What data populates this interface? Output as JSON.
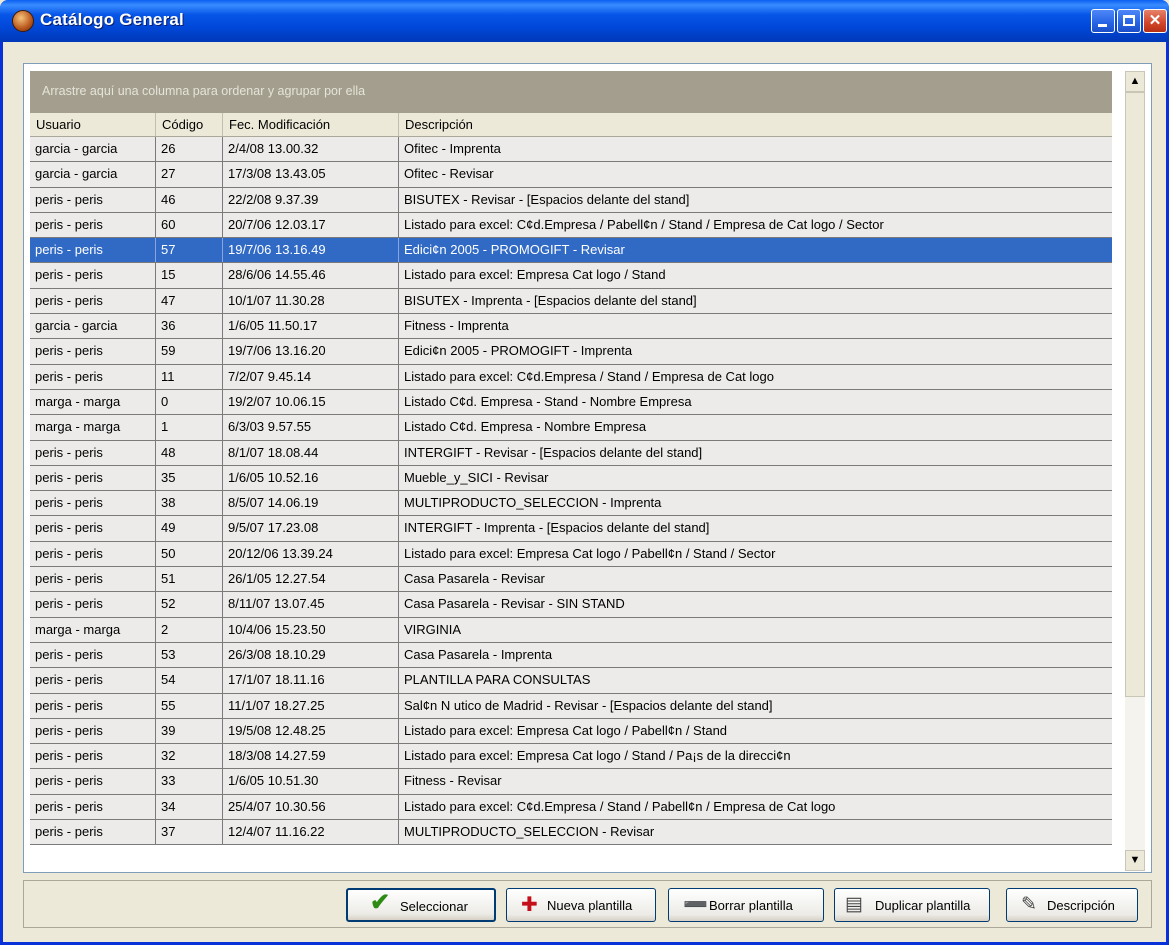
{
  "window": {
    "title": "Catálogo General"
  },
  "grid": {
    "group_hint": "Arrastre aquí una columna para ordenar y agrupar por ella",
    "columns": [
      "Usuario",
      "Código",
      "Fec. Modificación",
      "Descripción"
    ],
    "selected_index": 4,
    "rows": [
      [
        "garcia - garcia",
        "26",
        "2/4/08 13.00.32",
        "Ofitec - Imprenta"
      ],
      [
        "garcia - garcia",
        "27",
        "17/3/08 13.43.05",
        "Ofitec - Revisar"
      ],
      [
        "peris - peris",
        "46",
        "22/2/08 9.37.39",
        "BISUTEX - Revisar - [Espacios delante del stand]"
      ],
      [
        "peris - peris",
        "60",
        "20/7/06 12.03.17",
        "Listado para excel: C¢d.Empresa / Pabell¢n / Stand / Empresa de Cat logo / Sector"
      ],
      [
        "peris - peris",
        "57",
        "19/7/06 13.16.49",
        "Edici¢n 2005 - PROMOGIFT - Revisar"
      ],
      [
        "peris - peris",
        "15",
        "28/6/06 14.55.46",
        "Listado para excel: Empresa Cat logo / Stand"
      ],
      [
        "peris - peris",
        "47",
        "10/1/07 11.30.28",
        "BISUTEX - Imprenta - [Espacios delante del stand]"
      ],
      [
        "garcia - garcia",
        "36",
        "1/6/05 11.50.17",
        "Fitness - Imprenta"
      ],
      [
        "peris - peris",
        "59",
        "19/7/06 13.16.20",
        "Edici¢n 2005 - PROMOGIFT - Imprenta"
      ],
      [
        "peris - peris",
        "11",
        "7/2/07 9.45.14",
        "Listado para excel: C¢d.Empresa / Stand / Empresa de Cat logo"
      ],
      [
        "marga - marga",
        "0",
        "19/2/07 10.06.15",
        "Listado C¢d. Empresa - Stand - Nombre Empresa"
      ],
      [
        "marga - marga",
        "1",
        "6/3/03 9.57.55",
        "Listado C¢d. Empresa - Nombre Empresa"
      ],
      [
        "peris - peris",
        "48",
        "8/1/07 18.08.44",
        "INTERGIFT - Revisar - [Espacios delante del stand]"
      ],
      [
        "peris - peris",
        "35",
        "1/6/05 10.52.16",
        "Mueble_y_SICI - Revisar"
      ],
      [
        "peris - peris",
        "38",
        "8/5/07 14.06.19",
        "MULTIPRODUCTO_SELECCION - Imprenta"
      ],
      [
        "peris - peris",
        "49",
        "9/5/07 17.23.08",
        "INTERGIFT - Imprenta - [Espacios delante del stand]"
      ],
      [
        "peris - peris",
        "50",
        "20/12/06 13.39.24",
        "Listado para excel: Empresa Cat logo / Pabell¢n / Stand / Sector"
      ],
      [
        "peris - peris",
        "51",
        "26/1/05 12.27.54",
        "Casa Pasarela - Revisar"
      ],
      [
        "peris - peris",
        "52",
        "8/11/07 13.07.45",
        "Casa Pasarela - Revisar - SIN STAND"
      ],
      [
        "marga - marga",
        "2",
        "10/4/06 15.23.50",
        "VIRGINIA"
      ],
      [
        "peris - peris",
        "53",
        "26/3/08 18.10.29",
        "Casa Pasarela - Imprenta"
      ],
      [
        "peris - peris",
        "54",
        "17/1/07 18.11.16",
        "PLANTILLA PARA CONSULTAS"
      ],
      [
        "peris - peris",
        "55",
        "11/1/07 18.27.25",
        "Sal¢n N utico de Madrid - Revisar - [Espacios delante del stand]"
      ],
      [
        "peris - peris",
        "39",
        "19/5/08 12.48.25",
        "Listado para excel: Empresa Cat logo / Pabell¢n / Stand"
      ],
      [
        "peris - peris",
        "32",
        "18/3/08 14.27.59",
        "Listado para excel: Empresa Cat logo / Stand / Pa¡s de la direcci¢n"
      ],
      [
        "peris - peris",
        "33",
        "1/6/05 10.51.30",
        "Fitness - Revisar"
      ],
      [
        "peris - peris",
        "34",
        "25/4/07 10.30.56",
        "Listado para excel: C¢d.Empresa / Stand / Pabell¢n / Empresa de Cat logo"
      ],
      [
        "peris - peris",
        "37",
        "12/4/07 11.16.22",
        "MULTIPRODUCTO_SELECCION - Revisar"
      ]
    ]
  },
  "buttons": {
    "select": "Seleccionar",
    "new_template": "Nueva plantilla",
    "delete_template": "Borrar plantilla",
    "duplicate_template": "Duplicar plantilla",
    "description": "Descripción"
  },
  "colors": {
    "title_bar": "#0054E3",
    "selection": "#316AC5",
    "group_bar": "#A39E8E"
  },
  "icons": {
    "app": "catalog-app-icon",
    "select": "check-icon",
    "new": "new-template-icon",
    "delete": "delete-template-icon",
    "duplicate": "duplicate-template-icon",
    "description": "description-icon"
  }
}
